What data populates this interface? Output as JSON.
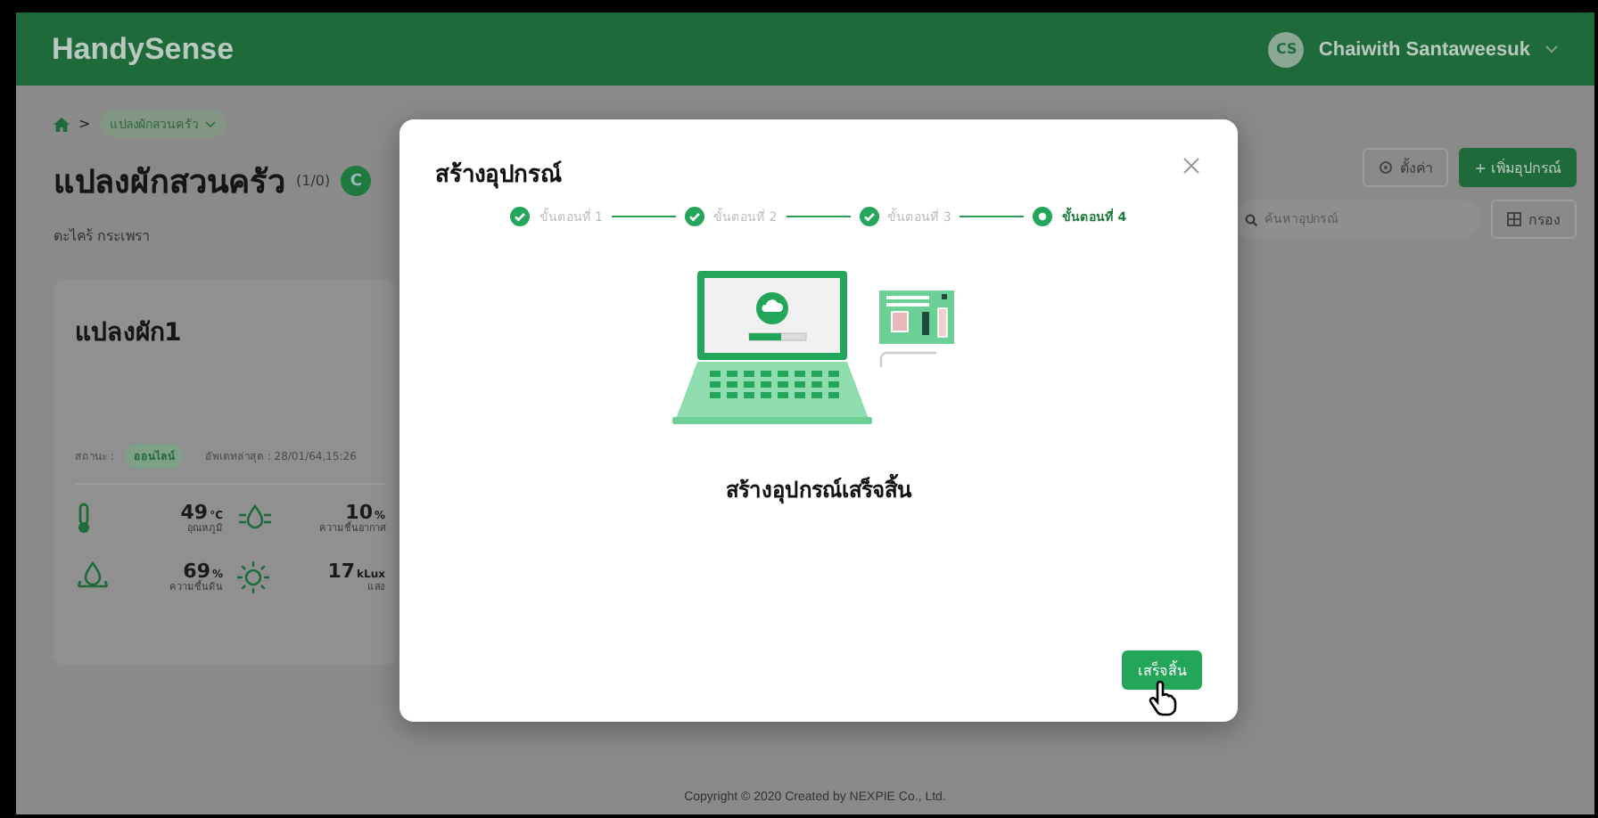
{
  "header": {
    "brand": "HandySense",
    "user": {
      "initials": "CS",
      "name": "Chaiwith Santaweesuk"
    }
  },
  "breadcrumb": {
    "separator": ">",
    "current": "แปลงผักสวนครัว"
  },
  "page": {
    "title": "แปลงผักสวนครัว",
    "count": "(1/0)",
    "badge": "C",
    "subtitle": "ตะไคร้ กระเพรา"
  },
  "actions": {
    "settings": "ตั้งค่า",
    "add": "+ เพิ่มอุปกรณ์",
    "search_placeholder": "ค้นหาอุปกรณ์",
    "filter": "กรอง"
  },
  "card": {
    "title": "แปลงผัก1",
    "status_label": "สถานะ :",
    "status": "ออนไลน์",
    "updated": "อัพเดทล่าสุด : 28/01/64,15:26",
    "sensors": [
      {
        "kind": "temperature",
        "value": "49",
        "unit": "°C",
        "label": "อุณหภูมิ"
      },
      {
        "kind": "humidity",
        "value": "10",
        "unit": "%",
        "label": "ความชื้นอากาศ"
      },
      {
        "kind": "soil",
        "value": "69",
        "unit": "%",
        "label": "ความชื้นดิน"
      },
      {
        "kind": "light",
        "value": "17",
        "unit": "kLux",
        "label": "แสง"
      }
    ]
  },
  "modal": {
    "title": "สร้างอุปกรณ์",
    "steps": [
      {
        "label": "ขั้นตอนที่ 1",
        "done": true,
        "selected": false
      },
      {
        "label": "ขั้นตอนที่ 2",
        "done": true,
        "selected": false
      },
      {
        "label": "ขั้นตอนที่ 3",
        "done": true,
        "selected": false
      },
      {
        "label": "ขั้นตอนที่ 4",
        "done": false,
        "selected": true
      }
    ],
    "message": "สร้างอุปกรณ์เสร็จสิ้น",
    "button": "เสร็จสิ้น"
  },
  "footer": "Copyright © 2020 Created by NEXPIE Co., Ltd."
}
